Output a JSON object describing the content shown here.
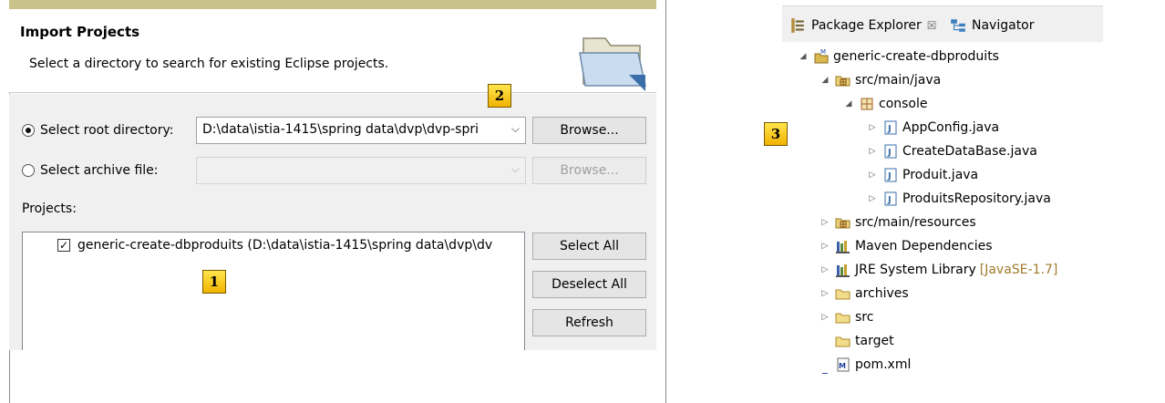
{
  "import_dialog": {
    "title": "Import Projects",
    "description": "Select a directory to search for existing Eclipse projects.",
    "root_directory": {
      "label": "Select root directory:",
      "value": "D:\\data\\istia-1415\\spring data\\dvp\\dvp-spri",
      "selected": true,
      "browse_label": "Browse..."
    },
    "archive_file": {
      "label": "Select archive file:",
      "value": "",
      "selected": false,
      "browse_label": "Browse..."
    },
    "projects_label": "Projects:",
    "projects": [
      {
        "label": "generic-create-dbproduits (D:\\data\\istia-1415\\spring data\\dvp\\dv",
        "checked": true
      }
    ],
    "buttons": {
      "select_all": "Select All",
      "deselect_all": "Deselect All",
      "refresh": "Refresh"
    }
  },
  "badges": {
    "b1": "1",
    "b2": "2",
    "b3": "3"
  },
  "package_explorer": {
    "tabs": [
      {
        "label": "Package Explorer",
        "close": "☒"
      },
      {
        "label": "Navigator"
      }
    ],
    "tree": {
      "project": "generic-create-dbproduits",
      "src_main_java": "src/main/java",
      "console_pkg": "console",
      "files": [
        "AppConfig.java",
        "CreateDataBase.java",
        "Produit.java",
        "ProduitsRepository.java"
      ],
      "src_main_resources": "src/main/resources",
      "maven_deps": "Maven Dependencies",
      "jre_lib": "JRE System Library",
      "jre_version": "[JavaSE-1.7]",
      "archives": "archives",
      "src": "src",
      "target": "target",
      "pom": "pom.xml"
    }
  },
  "colors": {
    "accent": "#c9c38a",
    "badge": "#f5c400",
    "decoration": "#a07a2b"
  }
}
